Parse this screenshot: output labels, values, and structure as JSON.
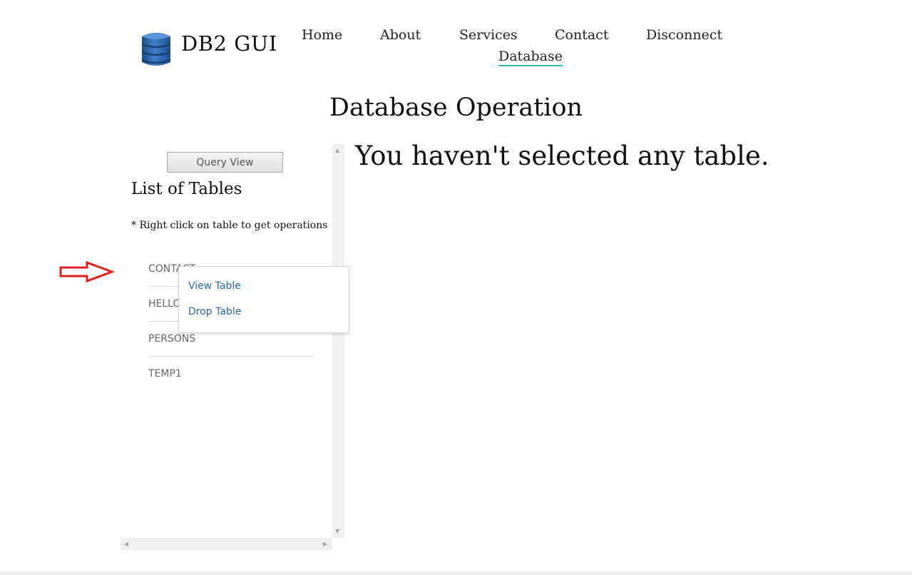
{
  "header": {
    "brand": "DB2 GUI",
    "logo_icon": "database-icon",
    "nav": [
      {
        "label": "Home"
      },
      {
        "label": "About"
      },
      {
        "label": "Services"
      },
      {
        "label": "Contact"
      },
      {
        "label": "Disconnect"
      },
      {
        "label": "Database",
        "active": true
      }
    ],
    "active_underline_color": "#2fb9a0"
  },
  "page_title": "Database Operation",
  "left_panel": {
    "query_view_label": "Query View",
    "heading": "List of Tables",
    "hint": "* Right click on table to get operations",
    "tables": [
      {
        "name": "CONTACT"
      },
      {
        "name": "HELLO"
      },
      {
        "name": "PERSONS"
      },
      {
        "name": "TEMP1"
      }
    ]
  },
  "context_menu": {
    "items": [
      {
        "label": "View Table"
      },
      {
        "label": "Drop Table"
      }
    ],
    "link_color": "#2d6aa8"
  },
  "main": {
    "message": "You haven't selected any table."
  },
  "annotation": {
    "arrow_icon": "red-outline-arrow-icon",
    "color": "#e0201e"
  }
}
